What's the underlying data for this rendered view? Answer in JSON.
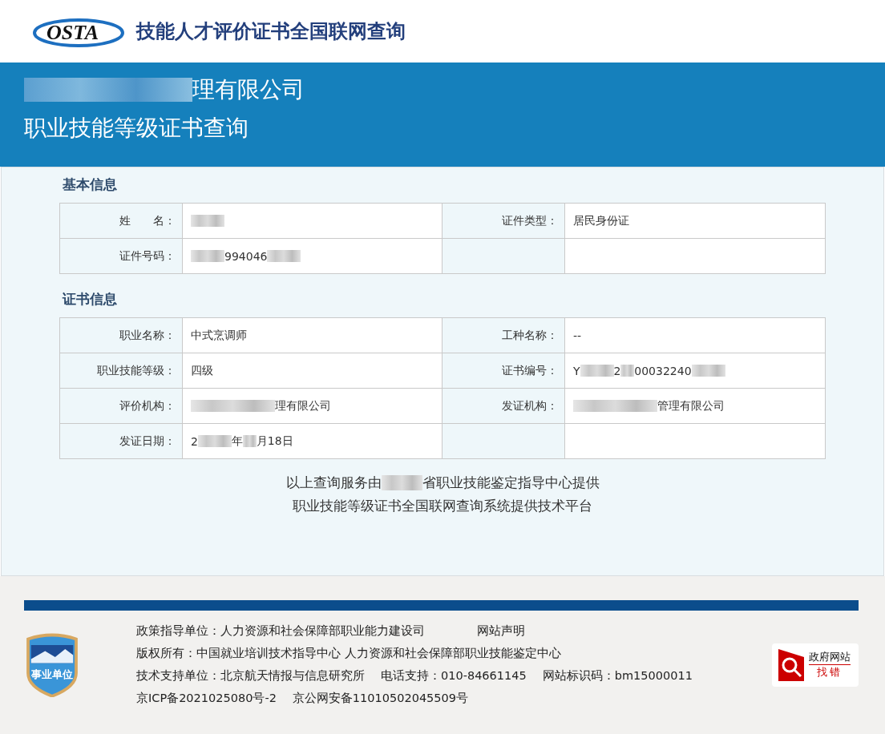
{
  "header": {
    "logo_text": "OSTA",
    "title": "技能人才评价证书全国联网查询"
  },
  "banner": {
    "lines": [
      [
        {
          "kind": "long_blur"
        },
        {
          "kind": "text",
          "text": "理有限公司"
        }
      ],
      [
        {
          "kind": "text",
          "text": "职业技能等级证书查询"
        }
      ]
    ]
  },
  "sections": [
    {
      "title": "基本信息",
      "rows": [
        [
          {
            "label": "姓　　名：",
            "value": [
              {
                "kind": "blur"
              }
            ]
          },
          {
            "label": "证件类型：",
            "value": [
              {
                "kind": "text",
                "text": "居民身份证"
              }
            ]
          }
        ],
        [
          {
            "label": "证件号码：",
            "value": [
              {
                "kind": "blur"
              },
              {
                "kind": "text",
                "text": "994046"
              },
              {
                "kind": "blur"
              }
            ]
          },
          {}
        ]
      ]
    },
    {
      "title": "证书信息",
      "rows": [
        [
          {
            "label": "职业名称：",
            "value": [
              {
                "kind": "text",
                "text": "中式烹调师"
              }
            ]
          },
          {
            "label": "工种名称：",
            "value": [
              {
                "kind": "text",
                "text": "--"
              }
            ]
          }
        ],
        [
          {
            "label": "职业技能等级：",
            "value": [
              {
                "kind": "text",
                "text": "四级"
              }
            ]
          },
          {
            "label": "证书编号：",
            "value": [
              {
                "kind": "text",
                "text": "Y"
              },
              {
                "kind": "blur"
              },
              {
                "kind": "text",
                "text": "2"
              },
              {
                "kind": "short_blur"
              },
              {
                "kind": "text",
                "text": "00032240"
              },
              {
                "kind": "blur"
              }
            ]
          }
        ],
        [
          {
            "label": "评价机构：",
            "value": [
              {
                "kind": "long_blur"
              },
              {
                "kind": "text",
                "text": "理有限公司"
              }
            ]
          },
          {
            "label": "发证机构：",
            "value": [
              {
                "kind": "long_blur"
              },
              {
                "kind": "text",
                "text": "管理有限公司"
              }
            ]
          }
        ],
        [
          {
            "label": "发证日期：",
            "value": [
              {
                "kind": "text",
                "text": "2"
              },
              {
                "kind": "blur"
              },
              {
                "kind": "text",
                "text": "年"
              },
              {
                "kind": "short_blur"
              },
              {
                "kind": "text",
                "text": "月18日"
              }
            ]
          },
          {}
        ]
      ]
    }
  ],
  "notes": [
    [
      {
        "kind": "text",
        "text": "以上查询服务由"
      },
      {
        "kind": "blur"
      },
      {
        "kind": "text",
        "text": "省职业技能鉴定指导中心提供"
      }
    ],
    [
      {
        "kind": "text",
        "text": "职业技能等级证书全国联网查询系统提供技术平台"
      }
    ]
  ],
  "footer": {
    "badge_text": "事业单位",
    "lines": [
      [
        "政策指导单位：人力资源和社会保障部职业能力建设司",
        "网站声明"
      ],
      [
        "版权所有：中国就业培训技术指导中心  人力资源和社会保障部职业技能鉴定中心"
      ],
      [
        "技术支持单位：北京航天情报与信息研究所",
        "电话支持：010-84661145",
        "网站标识码：bm15000011"
      ],
      [
        "京ICP备2021025080号-2",
        "京公网安备11010502045509号"
      ]
    ],
    "gov_badge": {
      "top": "政府网站",
      "bottom": "找错"
    }
  }
}
